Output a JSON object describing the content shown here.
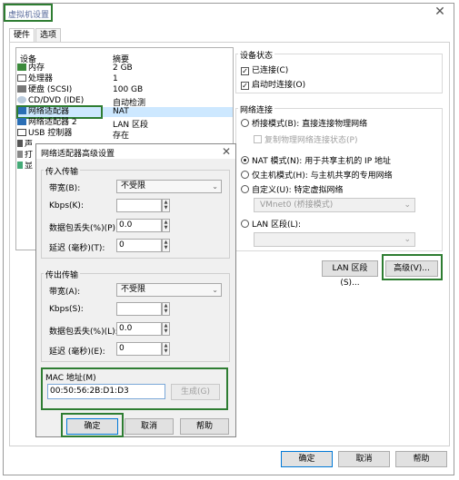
{
  "window": {
    "title": "虚拟机设置"
  },
  "tabs": [
    {
      "label": "硬件"
    },
    {
      "label": "选项"
    }
  ],
  "device_list": {
    "headers": {
      "device": "设备",
      "summary": "摘要"
    },
    "rows": [
      {
        "name": "内存",
        "summary": "2 GB",
        "icon": "memory-icon"
      },
      {
        "name": "处理器",
        "summary": "1",
        "icon": "processor-icon"
      },
      {
        "name": "硬盘 (SCSI)",
        "summary": "100 GB",
        "icon": "hard-disk-icon"
      },
      {
        "name": "CD/DVD (IDE)",
        "summary": "自动检测",
        "icon": "cd-dvd-icon"
      },
      {
        "name": "网络适配器",
        "summary": "NAT",
        "icon": "network-adapter-icon"
      },
      {
        "name": "网络适配器 2",
        "summary": "LAN 区段",
        "icon": "network-adapter-icon"
      },
      {
        "name": "USB 控制器",
        "summary": "存在",
        "icon": "usb-icon"
      },
      {
        "name": "声",
        "summary": "",
        "icon": "sound-icon"
      },
      {
        "name": "打",
        "summary": "",
        "icon": "printer-icon"
      },
      {
        "name": "显",
        "summary": "",
        "icon": "display-icon"
      }
    ]
  },
  "device_status": {
    "title": "设备状态",
    "connected": "已连接(C)",
    "connect_at_power_on": "启动时连接(O)"
  },
  "network_connection": {
    "title": "网络连接",
    "bridged": "桥接模式(B): 直接连接物理网络",
    "replicate": "复制物理网络连接状态(P)",
    "nat": "NAT 模式(N): 用于共享主机的 IP 地址",
    "host_only": "仅主机模式(H): 与主机共享的专用网络",
    "custom": "自定义(U): 特定虚拟网络",
    "custom_value": "VMnet0 (桥接模式)",
    "lan_segment": "LAN 区段(L):",
    "lan_segment_value": ""
  },
  "buttons": {
    "lan_segments": "LAN 区段(S)...",
    "advanced": "高级(V)...",
    "ok": "确定",
    "cancel": "取消",
    "help": "帮助"
  },
  "advanced_dialog": {
    "title": "网络适配器高级设置",
    "incoming": {
      "title": "传入传输",
      "bandwidth_label": "带宽(B):",
      "bandwidth_value": "不受限",
      "kbps_label": "Kbps(K):",
      "kbps_value": "",
      "loss_label": "数据包丢失(%)(P)",
      "loss_value": "0.0",
      "latency_label": "延迟 (毫秒)(T):",
      "latency_value": "0"
    },
    "outgoing": {
      "title": "传出传输",
      "bandwidth_label": "带宽(A):",
      "bandwidth_value": "不受限",
      "kbps_label": "Kbps(S):",
      "kbps_value": "",
      "loss_label": "数据包丢失(%)(L):",
      "loss_value": "0.0",
      "latency_label": "延迟 (毫秒)(E):",
      "latency_value": "0"
    },
    "mac": {
      "label": "MAC 地址(M)",
      "value": "00:50:56:2B:D1:D3",
      "generate": "生成(G)"
    },
    "buttons": {
      "ok": "确定",
      "cancel": "取消",
      "help": "帮助"
    }
  },
  "colors": {
    "highlight_green": "#2e7d32",
    "title_blue": "#5a6c9c",
    "selection_blue": "#cde8ff"
  }
}
